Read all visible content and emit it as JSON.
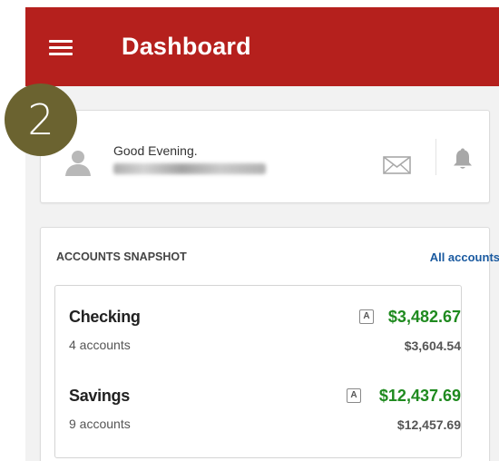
{
  "header": {
    "title": "Dashboard"
  },
  "step_badge": "2",
  "greeting": {
    "text": "Good Evening."
  },
  "snapshot": {
    "title": "ACCOUNTS SNAPSHOT",
    "all_accounts_link": "All accounts",
    "accounts": [
      {
        "name": "Checking",
        "count": "4 accounts",
        "badge": "A",
        "available": "$3,482.67",
        "current": "$3,604.54"
      },
      {
        "name": "Savings",
        "count": "9 accounts",
        "badge": "A",
        "available": "$12,437.69",
        "current": "$12,457.69"
      }
    ]
  },
  "colors": {
    "brand": "#b5201d",
    "positive": "#1f8a1f",
    "link": "#1a5aa0",
    "badge": "#6b6330"
  }
}
